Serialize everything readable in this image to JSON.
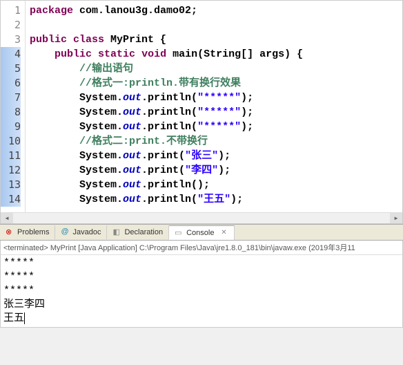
{
  "code": {
    "lines": [
      {
        "n": 1,
        "hl": false,
        "tokens": [
          {
            "t": "kw",
            "v": "package"
          },
          {
            "t": "",
            "v": " com.lanou3g.damo02;"
          }
        ]
      },
      {
        "n": 2,
        "hl": false,
        "tokens": []
      },
      {
        "n": 3,
        "hl": false,
        "tokens": [
          {
            "t": "kw",
            "v": "public"
          },
          {
            "t": "",
            "v": " "
          },
          {
            "t": "kw",
            "v": "class"
          },
          {
            "t": "",
            "v": " MyPrint {"
          }
        ]
      },
      {
        "n": 4,
        "hl": true,
        "tokens": [
          {
            "t": "",
            "v": "    "
          },
          {
            "t": "kw",
            "v": "public"
          },
          {
            "t": "",
            "v": " "
          },
          {
            "t": "kw",
            "v": "static"
          },
          {
            "t": "",
            "v": " "
          },
          {
            "t": "kw",
            "v": "void"
          },
          {
            "t": "",
            "v": " main(String[] args) {"
          }
        ]
      },
      {
        "n": 5,
        "hl": true,
        "tokens": [
          {
            "t": "",
            "v": "        "
          },
          {
            "t": "cmt",
            "v": "//输出语句"
          }
        ]
      },
      {
        "n": 6,
        "hl": true,
        "tokens": [
          {
            "t": "",
            "v": "        "
          },
          {
            "t": "cmt",
            "v": "//格式一:println."
          },
          {
            "t": "zh",
            "v": "带有换行效果"
          }
        ]
      },
      {
        "n": 7,
        "hl": true,
        "tokens": [
          {
            "t": "",
            "v": "        System."
          },
          {
            "t": "fld",
            "v": "out"
          },
          {
            "t": "",
            "v": ".println("
          },
          {
            "t": "str",
            "v": "\"*****\""
          },
          {
            "t": "",
            "v": ");"
          }
        ]
      },
      {
        "n": 8,
        "hl": true,
        "tokens": [
          {
            "t": "",
            "v": "        System."
          },
          {
            "t": "fld",
            "v": "out"
          },
          {
            "t": "",
            "v": ".println("
          },
          {
            "t": "str",
            "v": "\"*****\""
          },
          {
            "t": "",
            "v": ");"
          }
        ]
      },
      {
        "n": 9,
        "hl": true,
        "tokens": [
          {
            "t": "",
            "v": "        System."
          },
          {
            "t": "fld",
            "v": "out"
          },
          {
            "t": "",
            "v": ".println("
          },
          {
            "t": "str",
            "v": "\"*****\""
          },
          {
            "t": "",
            "v": ");"
          }
        ]
      },
      {
        "n": 10,
        "hl": true,
        "tokens": [
          {
            "t": "",
            "v": "        "
          },
          {
            "t": "cmt",
            "v": "//格式二:print."
          },
          {
            "t": "zh",
            "v": "不带换行"
          }
        ]
      },
      {
        "n": 11,
        "hl": true,
        "tokens": [
          {
            "t": "",
            "v": "        System."
          },
          {
            "t": "fld",
            "v": "out"
          },
          {
            "t": "",
            "v": ".print("
          },
          {
            "t": "str",
            "v": "\"张三\""
          },
          {
            "t": "",
            "v": ");"
          }
        ]
      },
      {
        "n": 12,
        "hl": true,
        "tokens": [
          {
            "t": "",
            "v": "        System."
          },
          {
            "t": "fld",
            "v": "out"
          },
          {
            "t": "",
            "v": ".print("
          },
          {
            "t": "str",
            "v": "\"李四\""
          },
          {
            "t": "",
            "v": ");"
          }
        ]
      },
      {
        "n": 13,
        "hl": true,
        "tokens": [
          {
            "t": "",
            "v": "        System."
          },
          {
            "t": "fld",
            "v": "out"
          },
          {
            "t": "",
            "v": ".println();"
          }
        ]
      },
      {
        "n": 14,
        "hl": true,
        "tokens": [
          {
            "t": "",
            "v": "        System."
          },
          {
            "t": "fld",
            "v": "out"
          },
          {
            "t": "",
            "v": ".println("
          },
          {
            "t": "str",
            "v": "\"王五\""
          },
          {
            "t": "",
            "v": ");"
          }
        ]
      }
    ]
  },
  "tabs": {
    "problems": "Problems",
    "javadoc": "Javadoc",
    "declaration": "Declaration",
    "console": "Console"
  },
  "console": {
    "header_prefix": "<terminated>",
    "header_text": "MyPrint [Java Application] C:\\Program Files\\Java\\jre1.8.0_181\\bin\\javaw.exe (2019年3月11",
    "output": [
      "*****",
      "*****",
      "*****",
      "张三李四",
      "王五"
    ]
  },
  "icons": {
    "error": "⊗",
    "at": "@",
    "decl": "◧",
    "console": "▭",
    "close": "✕"
  }
}
